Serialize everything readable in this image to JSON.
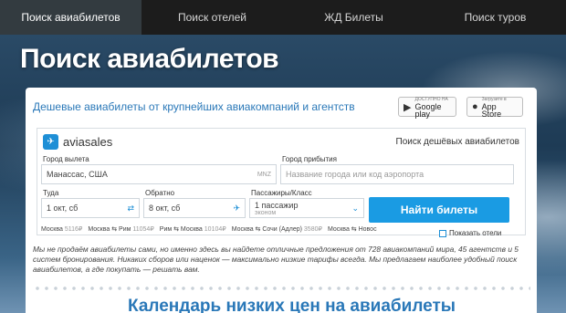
{
  "nav": {
    "tabs": [
      {
        "label": "Поиск авиабилетов",
        "active": true
      },
      {
        "label": "Поиск отелей",
        "active": false
      },
      {
        "label": "ЖД Билеты",
        "active": false
      },
      {
        "label": "Поиск туров",
        "active": false
      }
    ]
  },
  "page_title": "Поиск авиабилетов",
  "tagline": "Дешевые авиабилеты от крупнейших авиакомпаний и агентств",
  "stores": {
    "google_small": "ДОСТУПНО НА",
    "google_big": "Google play",
    "apple_small": "Загрузите в",
    "apple_big": "App Store"
  },
  "widget": {
    "logo_text": "aviasales",
    "heading": "Поиск дешёвых авиабилетов",
    "origin_label": "Город вылета",
    "origin_value": "Манассас, США",
    "origin_code": "MNZ",
    "destination_label": "Город прибытия",
    "destination_placeholder": "Название города или код аэропорта",
    "depart_label": "Туда",
    "depart_value": "1 окт, сб",
    "return_label": "Обратно",
    "return_value": "8 окт, сб",
    "passengers_label": "Пассажиры/Класс",
    "passengers_value": "1 пассажир",
    "class_value": "эконом",
    "search_button": "Найти билеты",
    "popular": [
      {
        "route": "Москва",
        "price": "5116₽"
      },
      {
        "route": "Москва ⇆ Рим",
        "price": "11054₽"
      },
      {
        "route": "Рим ⇆ Москва",
        "price": "10104₽"
      },
      {
        "route": "Москва ⇆ Сочи (Адлер)",
        "price": "3580₽"
      },
      {
        "route": "Москва ⇆ Новос",
        "price": ""
      }
    ],
    "hotels_checkbox": "Показать отели"
  },
  "description": "Мы не продаём авиабилеты сами, но именно здесь вы найдете отличные предложения от 728 авиакомпаний мира, 45 агентств и 5 систем бронирования. Никаких сборов или наценок — максимально низкие тарифы всегда. Мы предлагаем наиболее удобный поиск авиабилетов, а где покупать — решать вам.",
  "calendar_title": "Календарь низких цен на авиабилеты",
  "colors": {
    "accent": "#1a9be3",
    "link": "#2a78b8",
    "nav_bg": "#1c1c1c"
  }
}
